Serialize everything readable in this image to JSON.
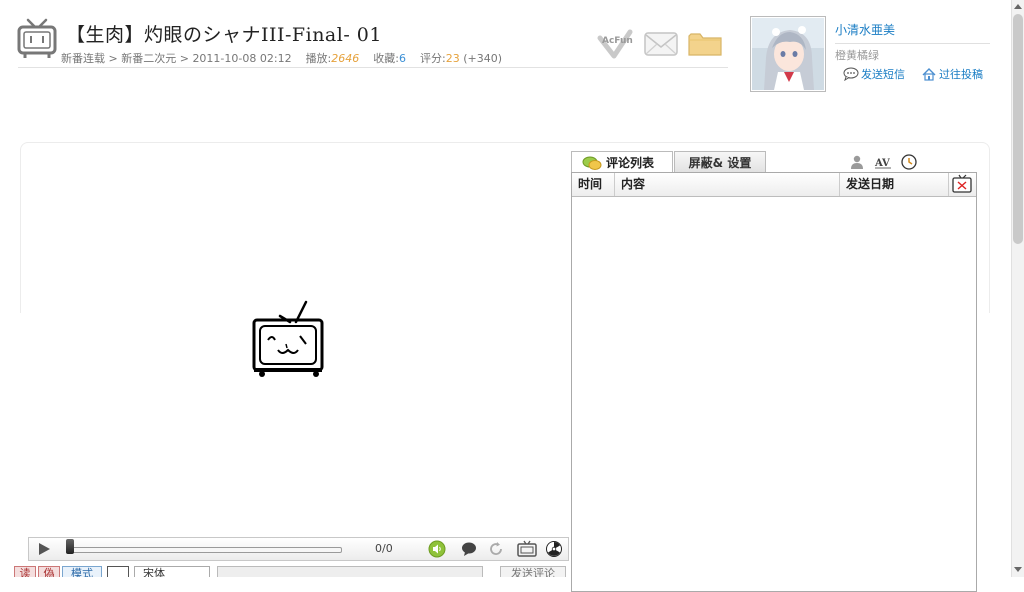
{
  "header": {
    "title": "【生肉】灼眼のシャナIII-Final- 01",
    "breadcrumb": {
      "level1": "新番连载",
      "sep1": " > ",
      "level2": "新番二次元",
      "sep2": " > ",
      "datetime": "2011-10-08 02:12"
    },
    "stats": {
      "plays_label": "播放:",
      "plays": "2646",
      "favorites_label": "收藏:",
      "favorites": "6",
      "score_label": "评分:",
      "score": "23",
      "score_extra": "(+340)"
    }
  },
  "user": {
    "name": "小清水亜美",
    "motto": "橙黄橘绿",
    "send_message": "发送短信",
    "past_posts": "过往投稿"
  },
  "player": {
    "time": "0/0",
    "progress": 0
  },
  "bottom_bar": {
    "tab1": "读",
    "tab2": "偽",
    "mode": "模式",
    "font": "宋体",
    "send": "发送评论"
  },
  "panel": {
    "tab_comments": "评论列表",
    "tab_settings": "屏蔽& 设置",
    "av_label": "AV",
    "columns": {
      "time": "时间",
      "content": "内容",
      "date": "发送日期"
    }
  },
  "colors": {
    "accent": "#1a7dc4",
    "highlight": "#e6a23c"
  }
}
